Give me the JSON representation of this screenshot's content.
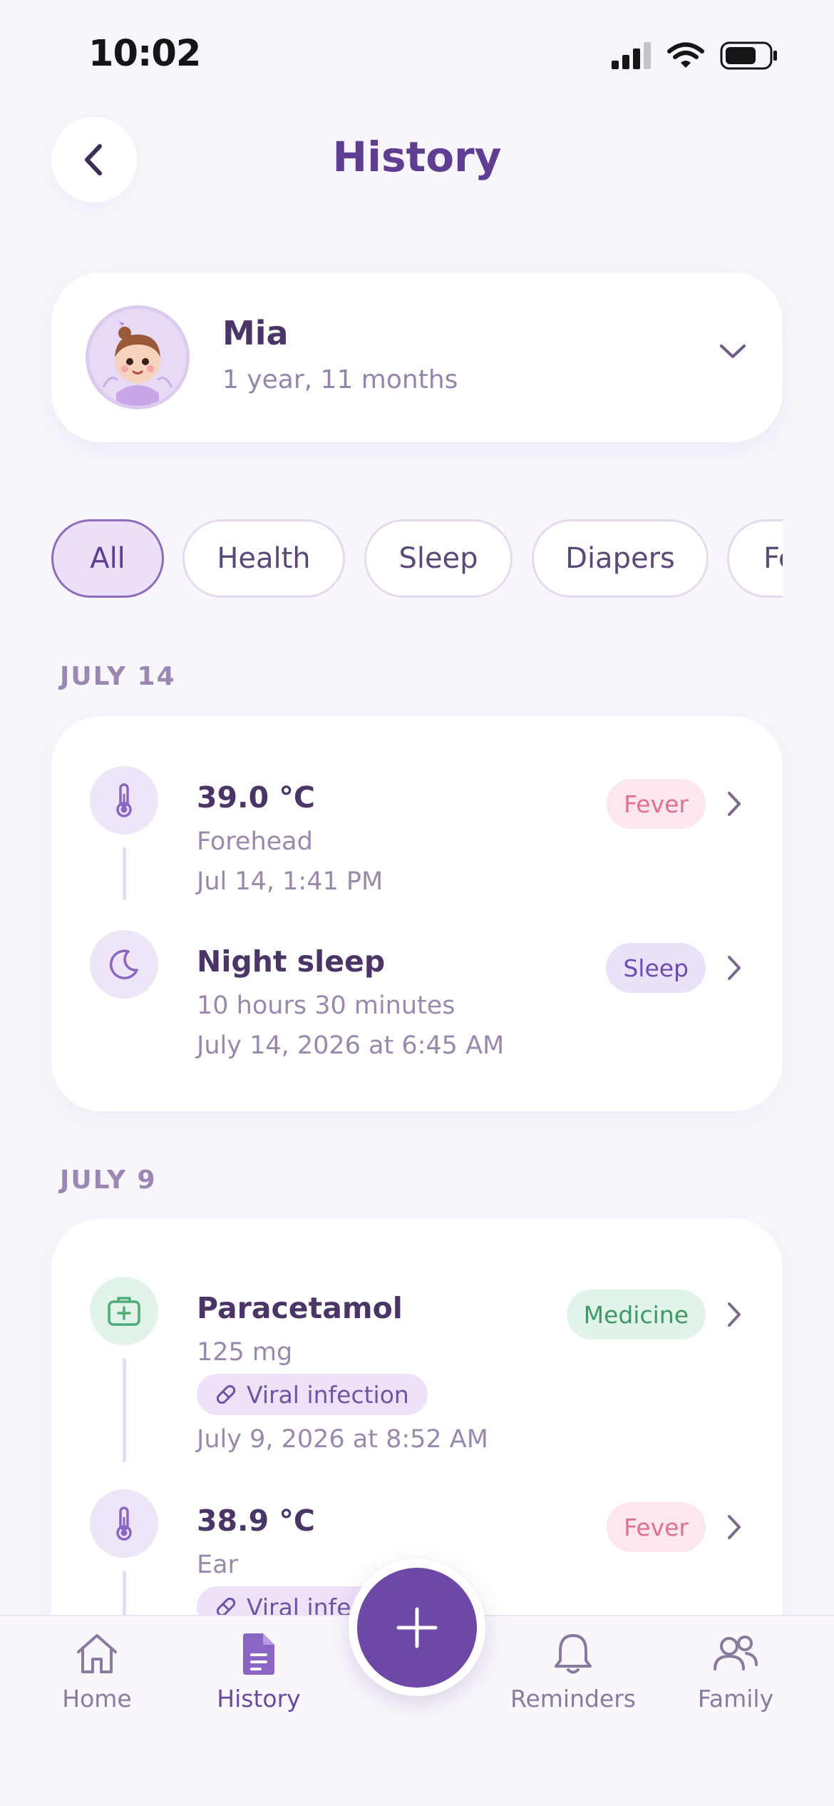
{
  "status_bar": {
    "time": "10:02"
  },
  "header": {
    "title": "History"
  },
  "profile": {
    "name": "Mia",
    "age": "1 year, 11 months"
  },
  "filters": [
    {
      "label": "All",
      "active": true
    },
    {
      "label": "Health",
      "active": false
    },
    {
      "label": "Sleep",
      "active": false
    },
    {
      "label": "Diapers",
      "active": false
    },
    {
      "label": "Fe",
      "active": false
    }
  ],
  "sections": [
    {
      "label": "JULY 14",
      "entries": [
        {
          "icon": "thermometer-icon",
          "title": "39.0 °C",
          "subtitle": "Forehead",
          "date": "Jul 14, 1:41 PM",
          "tag": "Fever"
        },
        {
          "icon": "moon-icon",
          "title": "Night sleep",
          "subtitle": "10 hours 30 minutes",
          "date": "July 14, 2026 at 6:45 AM",
          "tag": "Sleep"
        }
      ]
    },
    {
      "label": "JULY 9",
      "entries": [
        {
          "icon": "first-aid-kit-icon",
          "title": "Paracetamol",
          "subtitle": "125 mg",
          "condition": "Viral infection",
          "date": "July 9, 2026 at 8:52 AM",
          "tag": "Medicine"
        },
        {
          "icon": "thermometer-icon",
          "title": "38.9 °C",
          "subtitle": "Ear",
          "condition": "Viral infection",
          "tag": "Fever"
        }
      ]
    }
  ],
  "tab_bar": {
    "items": [
      {
        "label": "Home",
        "icon": "home-icon",
        "active": false
      },
      {
        "label": "History",
        "icon": "document-icon",
        "active": true
      },
      {
        "label": "Reminders",
        "icon": "bell-icon",
        "active": false
      },
      {
        "label": "Family",
        "icon": "people-icon",
        "active": false
      }
    ],
    "add_button_icon": "plus-icon"
  },
  "colors": {
    "background": "#f8f5fc",
    "accent": "#6d48a6",
    "title": "#5e3d92",
    "fever": "#e0708f",
    "sleep": "#6a4fb2",
    "medicine": "#3f9866"
  }
}
